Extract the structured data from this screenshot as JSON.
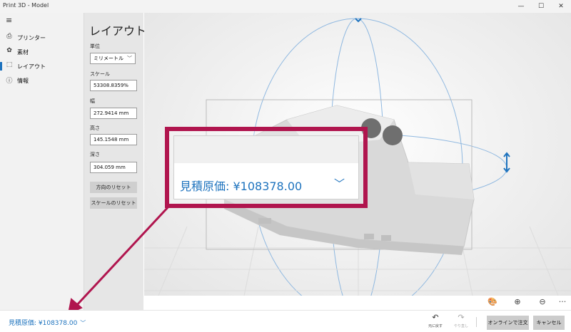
{
  "window": {
    "title": "Print 3D - Model",
    "min": "—",
    "max": "☐",
    "close": "✕"
  },
  "nav": {
    "menu_icon": "≡",
    "items": [
      {
        "label": "プリンター",
        "icon": "printer-icon",
        "glyph": "⎙"
      },
      {
        "label": "素材",
        "icon": "palette-icon",
        "glyph": "✿"
      },
      {
        "label": "レイアウト",
        "icon": "layout-icon",
        "glyph": "⬚",
        "active": true
      },
      {
        "label": "情報",
        "icon": "info-icon",
        "glyph": "ⓘ"
      }
    ]
  },
  "panel": {
    "title": "レイアウト",
    "unit_label": "単位",
    "unit_value": "ミリメートル",
    "scale_label": "スケール",
    "scale_value": "53308.8359%",
    "width_label": "幅",
    "width_value": "272.9414 mm",
    "height_label": "高さ",
    "height_value": "145.1548 mm",
    "depth_label": "深さ",
    "depth_value": "304.059 mm",
    "reset_orientation": "方向のリセット",
    "reset_scale": "スケールのリセット"
  },
  "viewport_tools": {
    "palette": "🎨",
    "zoom_in": "⊕",
    "zoom_out": "⊖",
    "more": "···"
  },
  "callout": {
    "text": "見積原価: ¥108378.00",
    "chevron": "﹀"
  },
  "bottom": {
    "price": "見積原価: ¥108378.00",
    "price_chevron": "﹀",
    "undo_label": "元に戻す",
    "redo_label": "やり直し",
    "undo_glyph": "↶",
    "redo_glyph": "↷",
    "order_online": "オンラインで注文",
    "cancel": "キャンセル"
  },
  "colors": {
    "accent": "#1e73be",
    "highlight": "#b0154e",
    "panel": "#e6e6e6",
    "nav": "#f2f2f2"
  }
}
